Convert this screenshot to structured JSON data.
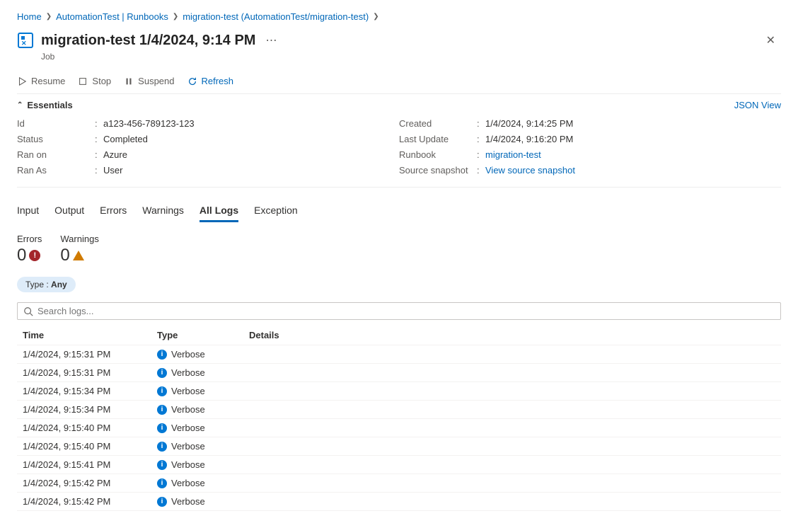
{
  "breadcrumbs": [
    {
      "label": "Home"
    },
    {
      "label": "AutomationTest | Runbooks"
    },
    {
      "label": "migration-test (AutomationTest/migration-test)"
    }
  ],
  "page_title": "migration-test 1/4/2024, 9:14 PM",
  "page_subtitle": "Job",
  "toolbar": {
    "resume": "Resume",
    "stop": "Stop",
    "suspend": "Suspend",
    "refresh": "Refresh"
  },
  "essentials": {
    "header": "Essentials",
    "json_view": "JSON View",
    "left": {
      "id_label": "Id",
      "id": "a123-456-789123-123",
      "status_label": "Status",
      "status": "Completed",
      "ran_on_label": "Ran on",
      "ran_on": "Azure",
      "ran_as_label": "Ran As",
      "ran_as": "User"
    },
    "right": {
      "created_label": "Created",
      "created": "1/4/2024, 9:14:25 PM",
      "last_update_label": "Last Update",
      "last_update": "1/4/2024, 9:16:20 PM",
      "runbook_label": "Runbook",
      "runbook": "migration-test",
      "snapshot_label": "Source snapshot",
      "snapshot": "View source snapshot"
    }
  },
  "tabs": [
    "Input",
    "Output",
    "Errors",
    "Warnings",
    "All Logs",
    "Exception"
  ],
  "active_tab": "All Logs",
  "counters": {
    "errors_label": "Errors",
    "errors_value": "0",
    "warnings_label": "Warnings",
    "warnings_value": "0"
  },
  "filter": {
    "label": "Type : ",
    "value": "Any"
  },
  "search_placeholder": "Search logs...",
  "table": {
    "headers": {
      "time": "Time",
      "type": "Type",
      "details": "Details"
    },
    "rows": [
      {
        "time": "1/4/2024, 9:15:31 PM",
        "type": "Verbose"
      },
      {
        "time": "1/4/2024, 9:15:31 PM",
        "type": "Verbose"
      },
      {
        "time": "1/4/2024, 9:15:34 PM",
        "type": "Verbose"
      },
      {
        "time": "1/4/2024, 9:15:34 PM",
        "type": "Verbose"
      },
      {
        "time": "1/4/2024, 9:15:40 PM",
        "type": "Verbose"
      },
      {
        "time": "1/4/2024, 9:15:40 PM",
        "type": "Verbose"
      },
      {
        "time": "1/4/2024, 9:15:41 PM",
        "type": "Verbose"
      },
      {
        "time": "1/4/2024, 9:15:42 PM",
        "type": "Verbose"
      },
      {
        "time": "1/4/2024, 9:15:42 PM",
        "type": "Verbose"
      }
    ]
  }
}
